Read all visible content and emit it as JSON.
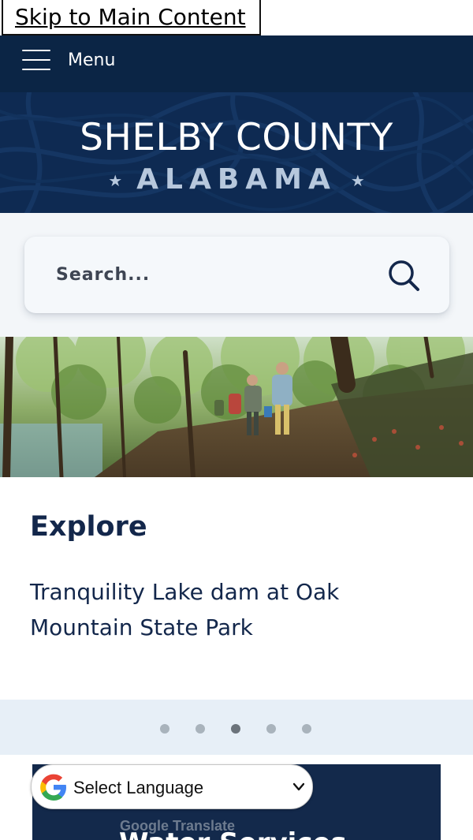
{
  "skip_link": "Skip to Main Content",
  "header": {
    "menu_label": "Menu",
    "logo_title": "SHELBY COUNTY",
    "logo_subtitle": "ALABAMA",
    "colors": {
      "nav_bg": "#0b2545",
      "banner_bg": "#0e2a52",
      "subtitle": "#b7c8dd"
    }
  },
  "search": {
    "placeholder": "Search...",
    "icon": "search-icon"
  },
  "slider": {
    "image": "hikers-on-forest-trail",
    "heading": "Explore",
    "caption": "Tranquility Lake dam at Oak Mountain State Park",
    "slide_count": 5,
    "active_index": 2
  },
  "services": {
    "title": "Water Services"
  },
  "translate": {
    "select_label": "Select Language",
    "powered_brand": "Google",
    "powered_text": "Translate"
  }
}
